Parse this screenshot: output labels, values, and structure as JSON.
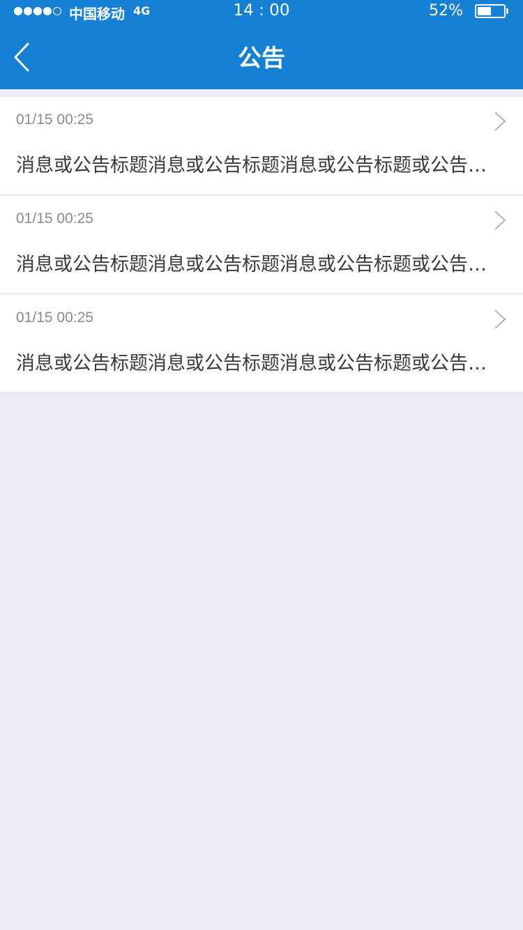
{
  "status_bar": {
    "carrier": "中国移动",
    "network": "4G",
    "time": "14 : 00",
    "battery_percent": "52%",
    "battery_level": 0.52,
    "signal_bars_filled": 4,
    "signal_bars_total": 5
  },
  "nav": {
    "title": "公告",
    "back_icon": "chevron-left-icon"
  },
  "notices": [
    {
      "date": "01/15 00:25",
      "title": "消息或公告标题消息或公告标题消息或公告标题或公告标题"
    },
    {
      "date": "01/15 00:25",
      "title": "消息或公告标题消息或公告标题消息或公告标题或公告标题"
    },
    {
      "date": "01/15 00:25",
      "title": "消息或公告标题消息或公告标题消息或公告标题或公告标题"
    }
  ],
  "colors": {
    "header": "#1580d3",
    "background": "#eceaf5",
    "item_background": "#ffffff"
  }
}
